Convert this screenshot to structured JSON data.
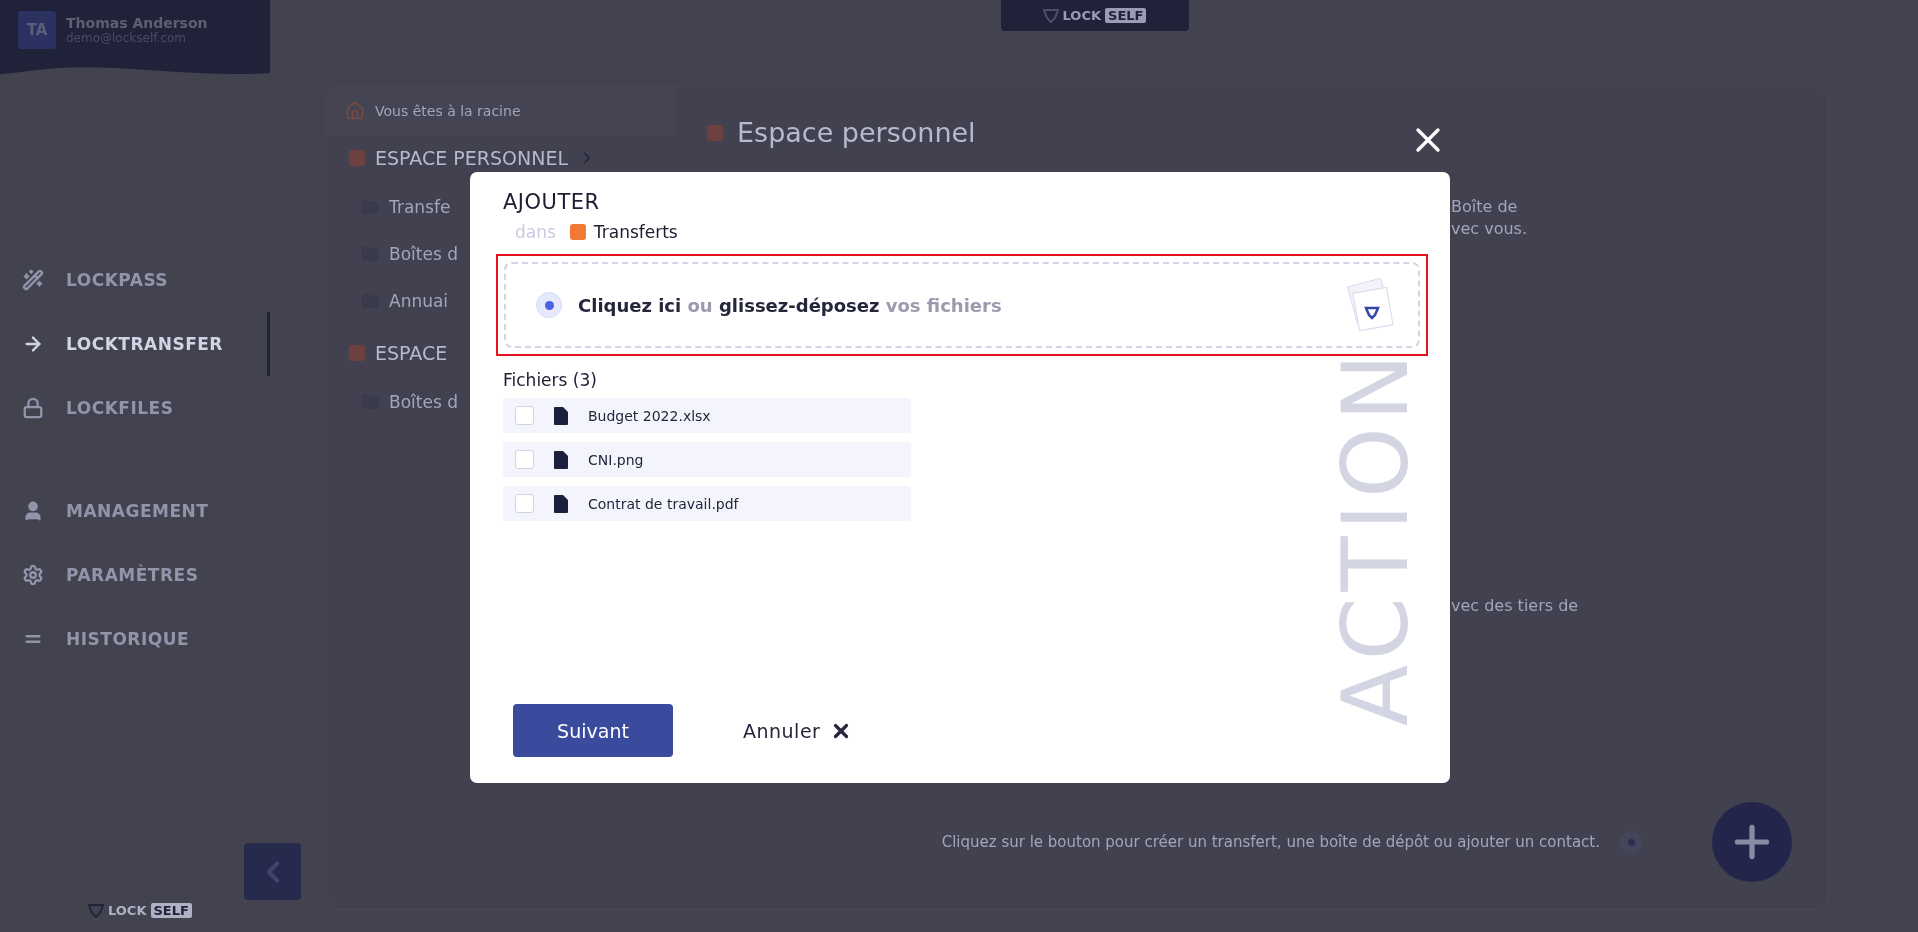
{
  "user": {
    "initials": "TA",
    "name": "Thomas Anderson",
    "email": "demo@lockself.com"
  },
  "nav": [
    {
      "kind": "key",
      "label": "LOCKPASS",
      "selected": false
    },
    {
      "kind": "arrow",
      "label": "LOCKTRANSFER",
      "selected": true
    },
    {
      "kind": "lock",
      "label": "LOCKFILES",
      "selected": false
    },
    {
      "kind": "user",
      "label": "MANAGEMENT",
      "selected": false
    },
    {
      "kind": "gears",
      "label": "PARAMÈTRES",
      "selected": false
    },
    {
      "kind": "bars",
      "label": "HISTORIQUE",
      "selected": false
    }
  ],
  "logo": {
    "word": "LOCK",
    "badge": "SELF"
  },
  "top_logo": {
    "word": "LOCK",
    "badge": "SELF"
  },
  "breadcrumb": "Vous êtes à la racine",
  "tree": [
    {
      "label": "ESPACE PERSONNEL",
      "children": [
        "Transfe",
        "Boîtes d",
        "Annuai"
      ]
    },
    {
      "label": "ESPACE",
      "children": [
        "Boîtes d"
      ]
    }
  ],
  "content": {
    "title": "Espace personnel",
    "paragraph_1": [
      "Boîte de",
      "vec vous."
    ],
    "paragraph_2": "vec des tiers de",
    "help": "Cliquez sur le bouton pour créer un transfert, une boîte de dépôt ou ajouter un contact."
  },
  "modal": {
    "title": "AJOUTER",
    "location_prefix": "dans",
    "location": "Transferts",
    "watermark_text": "ACTION",
    "dropzone": {
      "selected": true,
      "text": "**Cliquez ici** ou **glissez-déposez** vos fichiers"
    },
    "files_heading": "Fichiers (3)",
    "files": [
      {
        "name": "Budget 2022.xlsx",
        "checked": false
      },
      {
        "name": "CNI.png",
        "checked": false
      },
      {
        "name": "Contrat de travail.pdf",
        "checked": false
      }
    ],
    "next_button": "Suivant",
    "cancel_button": "Annuler"
  }
}
